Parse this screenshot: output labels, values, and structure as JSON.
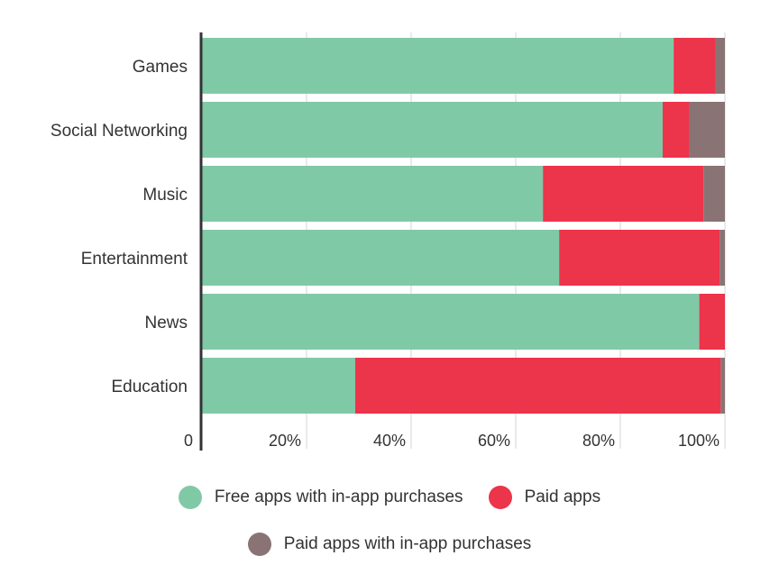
{
  "chart_data": {
    "type": "bar",
    "orientation": "horizontal",
    "stacked": true,
    "normalized": true,
    "categories": [
      "Games",
      "Social Networking",
      "Music",
      "Entertainment",
      "News",
      "Education"
    ],
    "series": [
      {
        "name": "Free apps with in-app purchases",
        "color": "#80c9a7",
        "values": [
          90.2,
          88.1,
          65.2,
          68.3,
          95.1,
          29.3
        ]
      },
      {
        "name": "Paid apps",
        "color": "#ec344b",
        "values": [
          8.0,
          5.1,
          30.7,
          30.7,
          4.9,
          69.9
        ]
      },
      {
        "name": "Paid apps with in-app purchases",
        "color": "#8a7374",
        "values": [
          1.8,
          6.8,
          4.1,
          1.0,
          0.0,
          0.8
        ]
      }
    ],
    "xlim": [
      0,
      100
    ],
    "xticks": [
      0,
      20,
      40,
      60,
      80,
      100
    ],
    "xtick_labels": [
      "0",
      "20%",
      "40%",
      "60%",
      "80%",
      "100%"
    ],
    "grid": "vertical",
    "legend": "bottom"
  }
}
